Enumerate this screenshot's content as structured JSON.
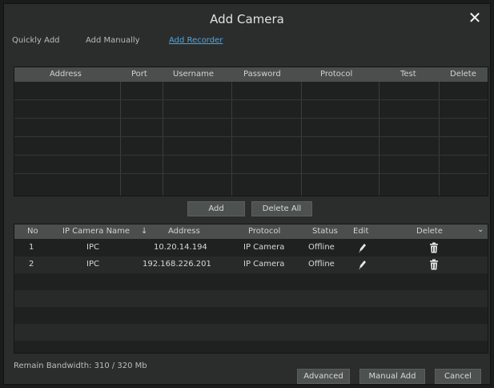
{
  "dialog": {
    "title": "Add Camera",
    "close_glyph": "✕"
  },
  "tabs": [
    {
      "label": "Quickly Add",
      "active": false
    },
    {
      "label": "Add Manually",
      "active": false
    },
    {
      "label": "Add Recorder",
      "active": true
    }
  ],
  "recorder_table": {
    "columns": [
      "Address",
      "Port",
      "Username",
      "Password",
      "Protocol",
      "Test",
      "Delete"
    ],
    "rows": []
  },
  "recorder_actions": {
    "add_label": "Add",
    "delete_all_label": "Delete All"
  },
  "camera_table": {
    "columns": [
      "No",
      "IP Camera Name",
      "Address",
      "Protocol",
      "Status",
      "Edit",
      "Delete"
    ],
    "sort_glyph": "↓",
    "dropdown_glyph": "⌄",
    "rows": [
      {
        "no": "1",
        "name": "IPC",
        "address": "10.20.14.194",
        "protocol": "IP Camera",
        "status": "Offline"
      },
      {
        "no": "2",
        "name": "IPC",
        "address": "192.168.226.201",
        "protocol": "IP Camera",
        "status": "Offline"
      }
    ],
    "edit_icon": "pencil-icon",
    "delete_icon": "trash-icon"
  },
  "footer": {
    "bandwidth": "Remain Bandwidth: 310 / 320 Mb",
    "advanced_label": "Advanced",
    "manual_add_label": "Manual Add",
    "cancel_label": "Cancel"
  },
  "colors": {
    "accent": "#4da6e8",
    "background": "#2a2d2c",
    "header": "#4a4e4c"
  }
}
